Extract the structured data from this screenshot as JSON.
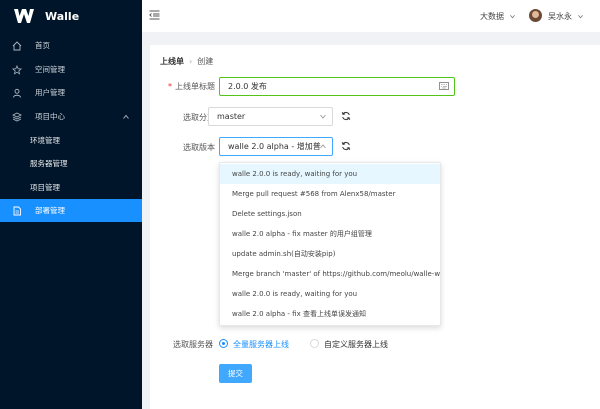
{
  "app": {
    "name": "Walle"
  },
  "sidebar": {
    "items": [
      {
        "label": "首页",
        "icon": "home-icon"
      },
      {
        "label": "空间管理",
        "icon": "star-icon"
      },
      {
        "label": "用户管理",
        "icon": "user-icon"
      },
      {
        "label": "项目中心",
        "icon": "layers-icon"
      },
      {
        "label": "环境管理"
      },
      {
        "label": "服务器管理"
      },
      {
        "label": "项目管理"
      },
      {
        "label": "部署管理",
        "icon": "file-icon",
        "active": true
      }
    ]
  },
  "header": {
    "space": "大数据",
    "user": "吴水永"
  },
  "breadcrumb": {
    "parent": "上线单",
    "current": "创建"
  },
  "form": {
    "title_label": "上线单标题",
    "title_value": "2.0.0 发布",
    "branch_label": "选取分支",
    "branch_value": "master",
    "version_label": "选取版本",
    "version_value": "walle 2.0 alpha -  增加普",
    "server_label": "选取服务器",
    "server_options": [
      "全量服务器上线",
      "自定义服务器上线"
    ],
    "submit_label": "提交"
  },
  "dropdown": {
    "items": [
      "walle 2.0.0 is ready, waiting for you",
      "Merge pull request #568 from Alenx58/master",
      "Delete settings.json",
      "walle 2.0 alpha - fix master 的用户组管理",
      "update admin.sh(自动安装pip)",
      "Merge branch 'master' of https://github.com/meolu/walle-web",
      "walle 2.0.0 is ready, waiting for you",
      "walle 2.0 alpha - fix 查看上线单误发通知"
    ]
  },
  "colors": {
    "sidebar": "#001529",
    "accent": "#1890ff",
    "focus": "#52c41a"
  }
}
